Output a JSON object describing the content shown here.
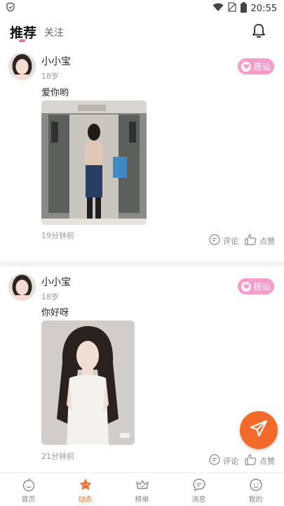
{
  "status_bar": {
    "time": "20:55"
  },
  "header": {
    "tabs": [
      {
        "label": "推荐",
        "active": true
      },
      {
        "label": "关注",
        "active": false
      }
    ]
  },
  "posts": [
    {
      "username": "小小宝",
      "age": "18岁",
      "chat_label": "搭讪",
      "text": "爱你哟",
      "time_ago": "19分钟前",
      "comment_label": "评论",
      "like_label": "点赞"
    },
    {
      "username": "小小宝",
      "age": "18岁",
      "chat_label": "搭讪",
      "text": "你好呀",
      "time_ago": "21分钟前",
      "comment_label": "评论",
      "like_label": "点赞"
    }
  ],
  "bottom_nav": {
    "items": [
      {
        "label": "首页",
        "icon": "home-icon"
      },
      {
        "label": "动态",
        "icon": "moments-icon",
        "active": true
      },
      {
        "label": "榜单",
        "icon": "crown-icon"
      },
      {
        "label": "消息",
        "icon": "message-icon"
      },
      {
        "label": "我的",
        "icon": "profile-icon"
      }
    ]
  },
  "colors": {
    "accent": "#f26b2a",
    "pink": "#f59ccb",
    "tab_indicator": "#f06aa8"
  }
}
